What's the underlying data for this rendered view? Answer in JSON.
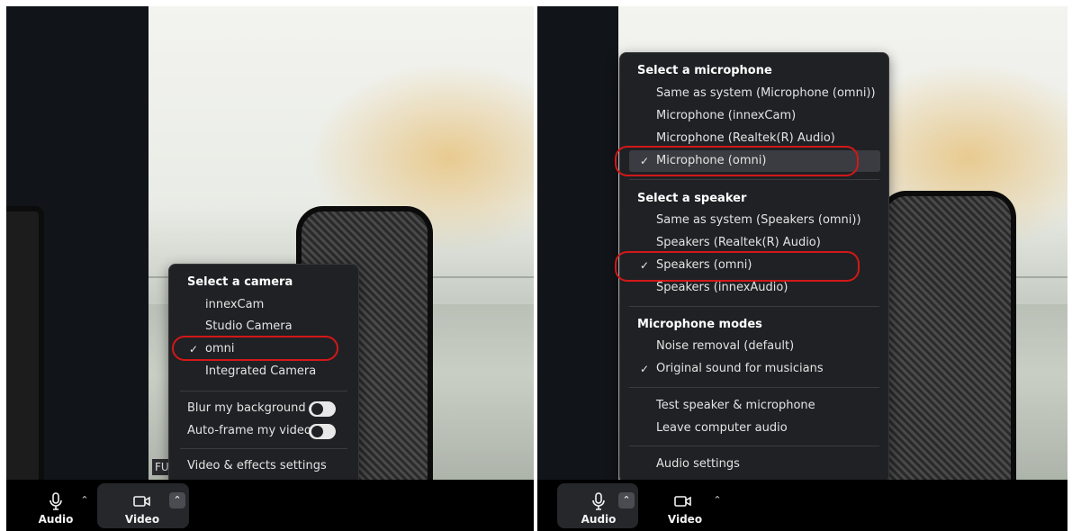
{
  "left": {
    "camera_menu": {
      "title": "Select a camera",
      "cameras": [
        {
          "label": "innexCam",
          "checked": false
        },
        {
          "label": "Studio Camera",
          "checked": false
        },
        {
          "label": "omni",
          "checked": true
        },
        {
          "label": "Integrated Camera",
          "checked": false
        }
      ],
      "blur_label": "Blur my background",
      "blur_on": false,
      "autoframe_label": "Auto-frame my video",
      "autoframe_on": false,
      "settings_label": "Video & effects settings"
    },
    "name_tag": "FU",
    "toolbar": {
      "audio_label": "Audio",
      "video_label": "Video"
    }
  },
  "right": {
    "audio_menu": {
      "mic_title": "Select a microphone",
      "microphones": [
        {
          "label": "Same as system (Microphone (omni))",
          "checked": false
        },
        {
          "label": "Microphone (innexCam)",
          "checked": false
        },
        {
          "label": "Microphone (Realtek(R) Audio)",
          "checked": false
        },
        {
          "label": "Microphone (omni)",
          "checked": true
        }
      ],
      "speaker_title": "Select a speaker",
      "speakers": [
        {
          "label": "Same as system (Speakers (omni))",
          "checked": false
        },
        {
          "label": "Speakers (Realtek(R) Audio)",
          "checked": false
        },
        {
          "label": "Speakers (omni)",
          "checked": true
        },
        {
          "label": "Speakers (innexAudio)",
          "checked": false
        }
      ],
      "modes_title": "Microphone modes",
      "modes": [
        {
          "label": "Noise removal (default)",
          "checked": false
        },
        {
          "label": "Original sound for musicians",
          "checked": true
        }
      ],
      "test_label": "Test speaker & microphone",
      "leave_label": "Leave computer audio",
      "settings_label": "Audio settings"
    },
    "toolbar": {
      "audio_label": "Audio",
      "video_label": "Video"
    }
  },
  "colors": {
    "menu_bg": "#202124",
    "highlight_ring": "#d21818",
    "toolbar_bg": "#000000"
  },
  "check_glyph": "✓",
  "caret_glyph": "⌃"
}
